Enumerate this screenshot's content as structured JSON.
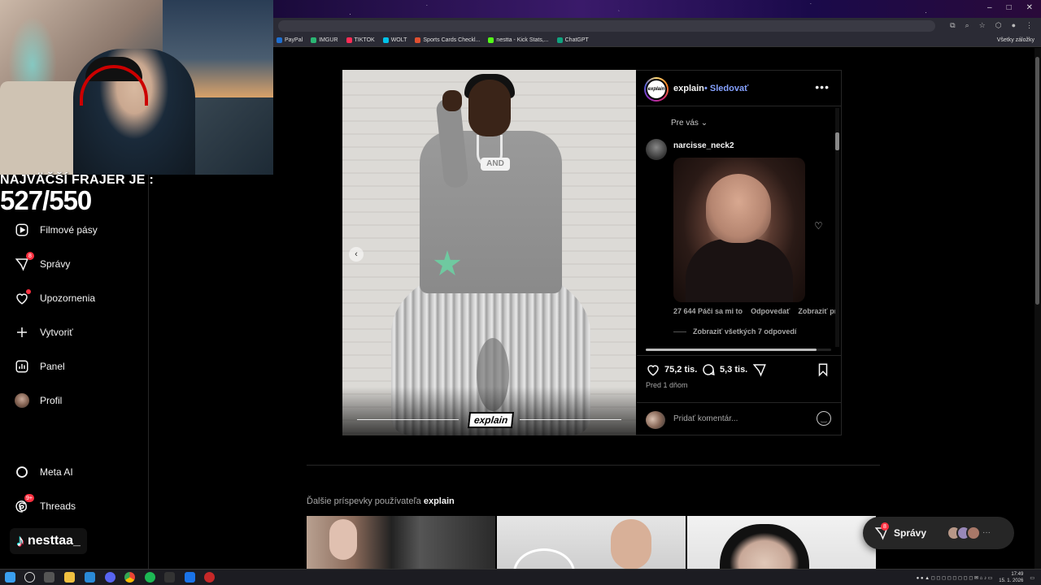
{
  "overlay": {
    "title": "NAJVÄČŠÍ FRAJER JE :",
    "count": "527/550"
  },
  "bookmarks": [
    {
      "label": "PayPal",
      "color": "#1f6fd0"
    },
    {
      "label": "IMGUR",
      "color": "#2bb673"
    },
    {
      "label": "TIKTOK",
      "color": "#fe2c55"
    },
    {
      "label": "WOLT",
      "color": "#00c2e8"
    },
    {
      "label": "Sports Cards Checkl...",
      "color": "#e05030"
    },
    {
      "label": "nestta - Kick Stats,...",
      "color": "#53fc18"
    },
    {
      "label": "ChatGPT",
      "color": "#10a37f"
    }
  ],
  "bookmarks_all": "Všetky záložky",
  "nav": {
    "reels": "Filmové pásy",
    "messages": "Správy",
    "messages_badge": "8",
    "notifications": "Upozornenia",
    "create": "Vytvoriť",
    "dashboard": "Panel",
    "profile": "Profil",
    "meta_ai": "Meta AI",
    "threads": "Threads",
    "threads_badge": "9+"
  },
  "tiktok_handle": "nesttaa_",
  "post": {
    "author": "explain",
    "follow": "• Sledovať",
    "logo_text": "explain",
    "pendant_text": "AND",
    "sort_label": "Pre vás",
    "comment": {
      "user": "narcisse_neck2",
      "likes": "27 644 Páči sa mi to",
      "reply": "Odpovedať",
      "translate": "Zobraziť preklad",
      "view_replies": "Zobraziť všetkých 7 odpovedí"
    },
    "like_count": "75,2 tis.",
    "comment_count": "5,3 tis.",
    "time_ago": "Pred 1 dňom",
    "comment_placeholder": "Pridať komentár..."
  },
  "more_posts": {
    "prefix": "Ďalšie príspevky používateľa ",
    "user": "explain"
  },
  "messages_pill": {
    "label": "Správy",
    "badge": "8"
  },
  "taskbar": {
    "time": "17:49",
    "date": "15. 1. 2026"
  },
  "colors": {
    "follow": "#85a1ff",
    "badge": "#ff3040",
    "background": "#000000"
  }
}
